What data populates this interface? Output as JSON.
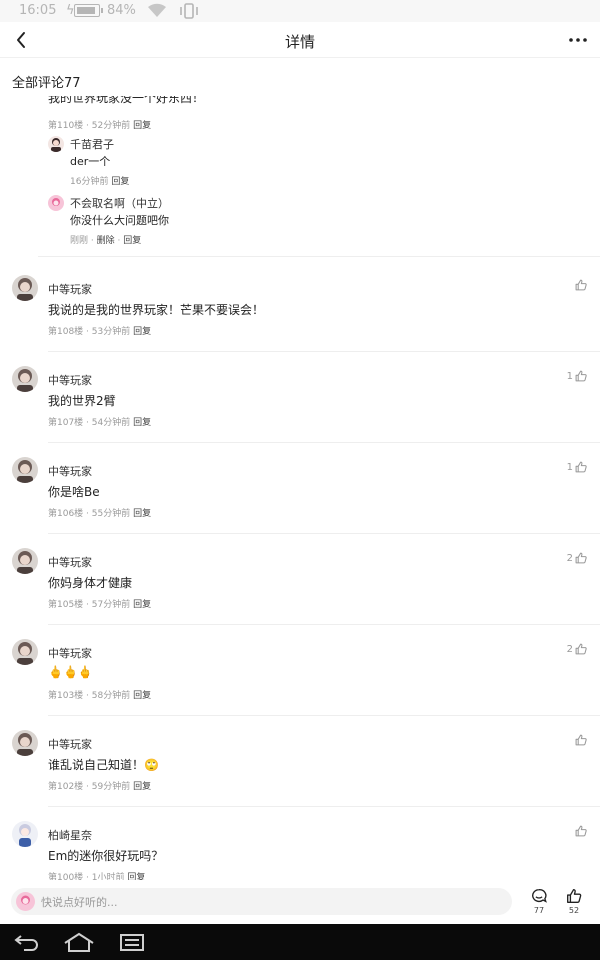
{
  "status": {
    "time": "16:05",
    "battery": "84%"
  },
  "nav": {
    "title": "详情"
  },
  "section": {
    "title": "全部评论77"
  },
  "partial_top": {
    "text": "我的世界玩家没一个好东西！",
    "floor": "第110楼",
    "time": "52分钟前",
    "reply": "回复"
  },
  "sub_comments": [
    {
      "name": "千苗君子",
      "text": "der一个",
      "time": "16分钟前",
      "reply": "回复"
    },
    {
      "name": "不会取名啊（中立）",
      "text": "你没什么大问题吧你",
      "time": "刚刚",
      "delete": "删除",
      "reply": "回复"
    }
  ],
  "comments": [
    {
      "name": "中等玩家",
      "text": "我说的是我的世界玩家！芒果不要误会！",
      "floor": "第108楼",
      "time": "53分钟前",
      "reply": "回复",
      "likes": ""
    },
    {
      "name": "中等玩家",
      "text": "我的世界2臂",
      "floor": "第107楼",
      "time": "54分钟前",
      "reply": "回复",
      "likes": "1"
    },
    {
      "name": "中等玩家",
      "text": "你是啥Be",
      "floor": "第106楼",
      "time": "55分钟前",
      "reply": "回复",
      "likes": "1"
    },
    {
      "name": "中等玩家",
      "text": "你妈身体才健康",
      "floor": "第105楼",
      "time": "57分钟前",
      "reply": "回复",
      "likes": "2"
    },
    {
      "name": "中等玩家",
      "text": "🖕🖕🖕",
      "floor": "第103楼",
      "time": "58分钟前",
      "reply": "回复",
      "likes": "2"
    },
    {
      "name": "中等玩家",
      "text": "谁乱说自己知道！🙄",
      "floor": "第102楼",
      "time": "59分钟前",
      "reply": "回复",
      "likes": ""
    },
    {
      "name": "柏崎星奈",
      "text": "Em的迷你很好玩吗？",
      "floor": "第100楼",
      "time": "1小时前",
      "reply": "回复",
      "likes": ""
    }
  ],
  "bottom": {
    "placeholder": "快说点好听的...",
    "comment_count": "77",
    "like_count": "52"
  },
  "icons": [
    "back-icon",
    "more-icon",
    "thumb-up-icon",
    "comment-icon",
    "android-back-icon",
    "android-home-icon",
    "android-recent-icon",
    "wifi-icon",
    "battery-icon",
    "vibrate-icon"
  ]
}
